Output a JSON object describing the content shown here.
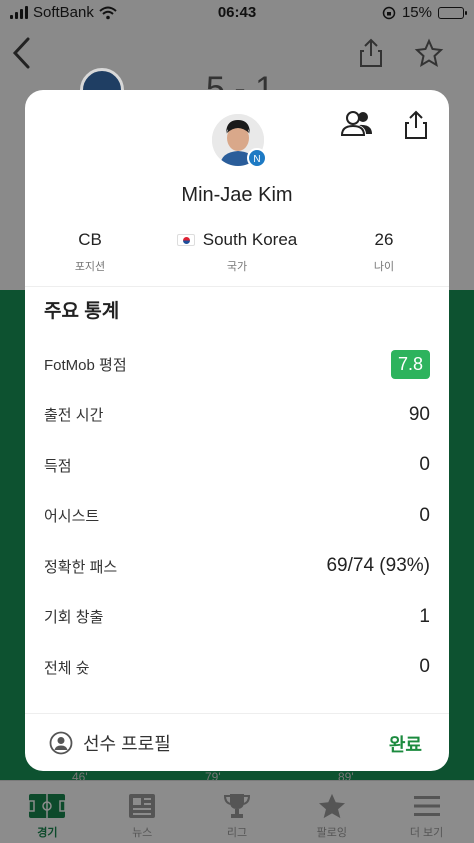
{
  "status_bar": {
    "carrier": "SoftBank",
    "time": "06:43",
    "battery": "15%",
    "battery_fraction": 0.15
  },
  "background": {
    "score": "5 - 1",
    "minutes": [
      "46'",
      "79'",
      "89'"
    ]
  },
  "tab_bar": {
    "tabs": [
      {
        "label": "경기",
        "icon": "soccer-field-icon",
        "active": true
      },
      {
        "label": "뉴스",
        "icon": "newspaper-icon",
        "active": false
      },
      {
        "label": "리그",
        "icon": "trophy-icon",
        "active": false
      },
      {
        "label": "팔로잉",
        "icon": "star-icon",
        "active": false
      },
      {
        "label": "더 보기",
        "icon": "menu-icon",
        "active": false
      }
    ]
  },
  "player_card": {
    "name": "Min-Jae Kim",
    "position": {
      "value": "CB",
      "label": "포지션"
    },
    "country": {
      "value": "South Korea",
      "label": "국가"
    },
    "age": {
      "value": "26",
      "label": "나이"
    },
    "section_title": "주요 통계",
    "stats": [
      {
        "label": "FotMob 평점",
        "value": "7.8",
        "badge": true
      },
      {
        "label": "출전 시간",
        "value": "90"
      },
      {
        "label": "득점",
        "value": "0"
      },
      {
        "label": "어시스트",
        "value": "0"
      },
      {
        "label": "정확한 패스",
        "value": "69/74 (93%)"
      },
      {
        "label": "기회 창출",
        "value": "1"
      },
      {
        "label": "전체 슛",
        "value": "0"
      }
    ],
    "footer": {
      "profile_label": "선수 프로필",
      "done_label": "완료"
    }
  },
  "colors": {
    "rating_green": "#2db35d",
    "done_green": "#1c8b3f",
    "pitch_green": "#0d5230"
  }
}
